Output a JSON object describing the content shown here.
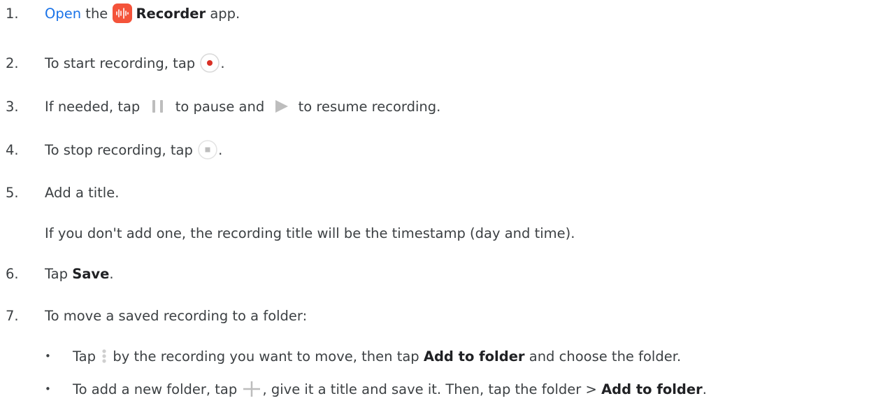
{
  "steps": [
    {
      "num": "1.",
      "link": "Open",
      "t1": " the ",
      "app_name": "Recorder",
      "t2": " app."
    },
    {
      "num": "2.",
      "t1": "To start recording, tap ",
      "t2": "."
    },
    {
      "num": "3.",
      "t1": "If needed, tap ",
      "t2": " to pause and ",
      "t3": " to resume recording."
    },
    {
      "num": "4.",
      "t1": "To stop recording, tap ",
      "t2": "."
    },
    {
      "num": "5.",
      "t1": "Add a title.",
      "note": "If you don't add one, the recording title will be the timestamp (day and time)."
    },
    {
      "num": "6.",
      "t1": "Tap ",
      "bold": "Save",
      "t2": "."
    },
    {
      "num": "7.",
      "t1": "To move a saved recording to a folder:"
    }
  ],
  "bullets": [
    {
      "mark": "•",
      "t1": "Tap ",
      "t2": " by the recording you want to move, then tap ",
      "bold": "Add to folder",
      "t3": " and choose the folder."
    },
    {
      "mark": "•",
      "t1": "To add a new folder, tap ",
      "t2": ", give it a title and save it. Then, tap the folder > ",
      "bold": "Add to folder",
      "t3": "."
    }
  ],
  "icons": {
    "recorder_app": "recorder-app-icon",
    "record": "record-icon",
    "pause": "pause-icon",
    "play": "play-icon",
    "stop": "stop-icon",
    "more": "more-vert-icon",
    "add": "add-icon"
  },
  "colors": {
    "link": "#1a73e8",
    "app_icon": "#f4533a",
    "record_dot": "#d93025",
    "icon_gray": "#bdbdbd"
  }
}
